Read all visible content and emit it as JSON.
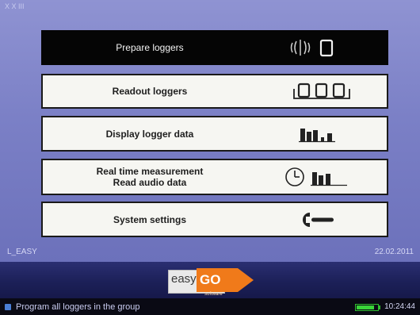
{
  "corner_label": "X X III",
  "menu": {
    "prepare": "Prepare loggers",
    "readout": "Readout loggers",
    "display": "Display logger data",
    "realtime_line1": "Real time measurement",
    "realtime_line2": "Read audio data",
    "settings": "System settings"
  },
  "footer": {
    "left": "L_EASY",
    "date": "22.02.2011"
  },
  "brand": {
    "easy": "easy",
    "go": "GO",
    "sub": "software"
  },
  "status": {
    "message": "Program all loggers in the group",
    "time": "10:24:44",
    "battery_level": 0.85
  },
  "colors": {
    "background": "#7b80c6",
    "active_button": "#050505",
    "button": "#f6f6f2",
    "brand_orange": "#f07a1a",
    "battery": "#39d439"
  },
  "icons": [
    "usb-logger-icon",
    "three-loggers-icon",
    "bar-chart-icon",
    "clock-icon",
    "wrench-icon"
  ]
}
